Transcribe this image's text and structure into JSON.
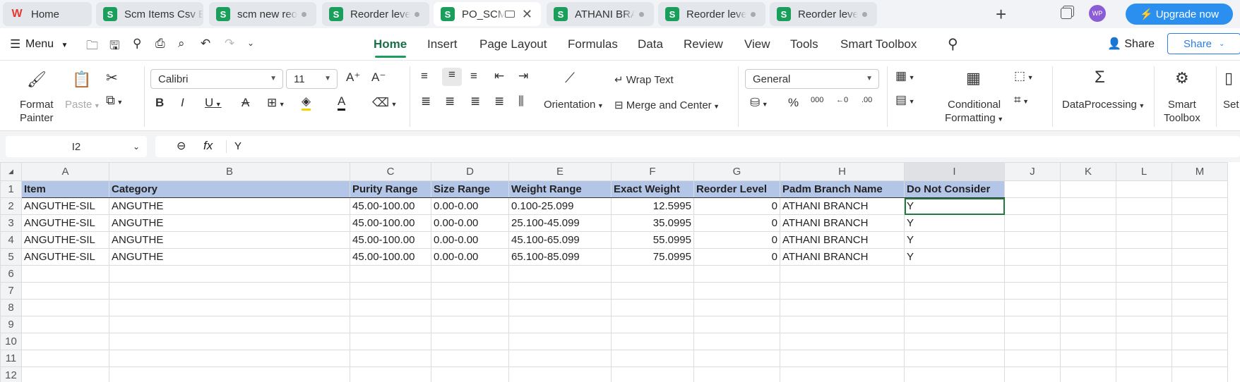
{
  "tabs": [
    {
      "label": "Home",
      "icon": "wps-logo-icon"
    },
    {
      "label": "Scm Items Csv Exp",
      "icon": "sheet-icon"
    },
    {
      "label": "scm new reorde",
      "icon": "sheet-icon"
    },
    {
      "label": "Reorder level R",
      "icon": "sheet-icon"
    },
    {
      "label": "PO_SCM_fo",
      "icon": "sheet-icon"
    },
    {
      "label": "ATHANI BRANC",
      "icon": "sheet-icon"
    },
    {
      "label": "Reorder level R",
      "icon": "sheet-icon"
    },
    {
      "label": "Reorder level R",
      "icon": "sheet-icon"
    }
  ],
  "titlebar": {
    "avatar": "WP",
    "upgrade": "Upgrade now",
    "add_tab": "+"
  },
  "menu": {
    "label": "Menu",
    "tabs": [
      "Home",
      "Insert",
      "Page Layout",
      "Formulas",
      "Data",
      "Review",
      "View",
      "Tools",
      "Smart Toolbox"
    ],
    "active": "Home",
    "share_icon_label": "Share",
    "share_button": "Share"
  },
  "ribbon": {
    "format_painter": [
      "Format",
      "Painter"
    ],
    "paste": "Paste",
    "font": "Calibri",
    "font_size": "11",
    "wrap_text": "Wrap Text",
    "orientation": "Orientation",
    "merge_center": "Merge and Center",
    "number_format": "General",
    "conditional": [
      "Conditional",
      "Formatting"
    ],
    "dataprocessing": "DataProcessing",
    "smart_toolbox": [
      "Smart",
      "Toolbox"
    ],
    "settings_partial": "Set"
  },
  "formula": {
    "cell_ref": "I2",
    "fx": "fx",
    "value": "Y"
  },
  "columns": [
    "A",
    "B",
    "C",
    "D",
    "E",
    "F",
    "G",
    "H",
    "I",
    "J",
    "K",
    "L",
    "M"
  ],
  "rows": [
    "1",
    "2",
    "3",
    "4",
    "5",
    "6",
    "7",
    "8",
    "9",
    "10",
    "11",
    "12"
  ],
  "header": [
    "Item",
    "Category",
    "Purity Range",
    "Size Range",
    "Weight Range",
    "Exact Weight",
    "Reorder Level",
    "Padm Branch Name",
    "Do Not Consider"
  ],
  "data": [
    [
      "ANGUTHE-SIL",
      "ANGUTHE",
      "45.00-100.00",
      "0.00-0.00",
      "0.100-25.099",
      "12.5995",
      "0",
      "ATHANI BRANCH",
      "Y"
    ],
    [
      "ANGUTHE-SIL",
      "ANGUTHE",
      "45.00-100.00",
      "0.00-0.00",
      "25.100-45.099",
      "35.0995",
      "0",
      "ATHANI BRANCH",
      "Y"
    ],
    [
      "ANGUTHE-SIL",
      "ANGUTHE",
      "45.00-100.00",
      "0.00-0.00",
      "45.100-65.099",
      "55.0995",
      "0",
      "ATHANI BRANCH",
      "Y"
    ],
    [
      "ANGUTHE-SIL",
      "ANGUTHE",
      "45.00-100.00",
      "0.00-0.00",
      "65.100-85.099",
      "75.0995",
      "0",
      "ATHANI BRANCH",
      "Y"
    ]
  ],
  "colors": {
    "accent": "#1a9e5c",
    "header_fill": "#b4c6e7",
    "upgrade": "#2b8ff0"
  }
}
